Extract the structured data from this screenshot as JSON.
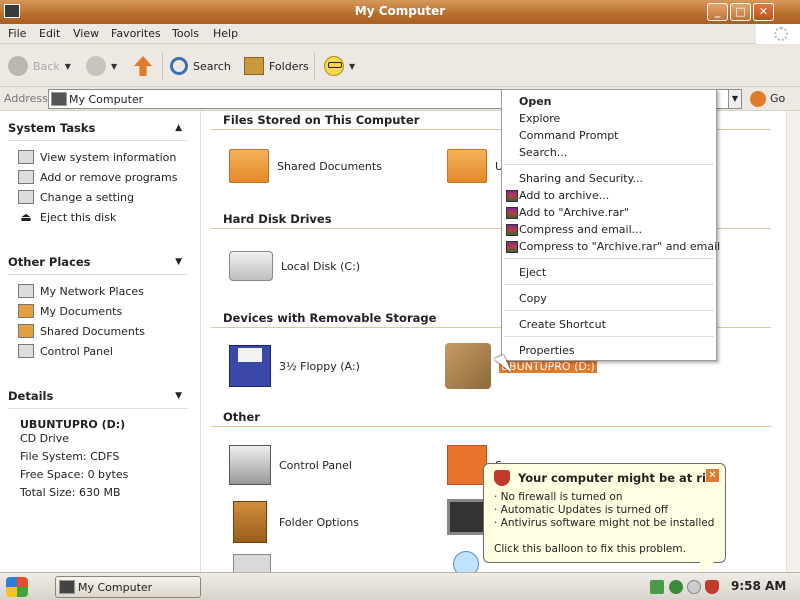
{
  "window": {
    "title": "My Computer"
  },
  "menu": {
    "items": [
      "File",
      "Edit",
      "View",
      "Favorites",
      "Tools",
      "Help"
    ]
  },
  "toolbar": {
    "back": "Back",
    "search": "Search",
    "folders": "Folders"
  },
  "address": {
    "label": "Address",
    "value": "My Computer",
    "go": "Go"
  },
  "sidebar": {
    "system_tasks": {
      "title": "System Tasks",
      "items": [
        "View system information",
        "Add or remove programs",
        "Change a setting",
        "Eject this disk"
      ]
    },
    "other_places": {
      "title": "Other Places",
      "items": [
        "My Network Places",
        "My Documents",
        "Shared Documents",
        "Control Panel"
      ]
    },
    "details": {
      "title": "Details",
      "name": "UBUNTUPRO (D:)",
      "type": "CD Drive",
      "filesystem": "File System: CDFS",
      "free": "Free Space: 0 bytes",
      "total": "Total Size: 630 MB"
    }
  },
  "main": {
    "groups": {
      "files": "Files Stored on This Computer",
      "hdd": "Hard Disk Drives",
      "removable": "Devices with Removable Storage",
      "other": "Other"
    },
    "items": {
      "shared_documents": "Shared Documents",
      "partial_folder": "U",
      "local_disk": "Local Disk (C:)",
      "floppy": "3½ Floppy (A:)",
      "cd_drive": "UBUNTUPRO (D:)",
      "control_panel": "Control Panel",
      "folder_options": "Folder Options",
      "partial_other": "Scanners ar"
    }
  },
  "context_menu": {
    "open": "Open",
    "explore": "Explore",
    "command_prompt": "Command Prompt",
    "search": "Search...",
    "sharing": "Sharing and Security...",
    "add_archive": "Add to archive...",
    "add_rar": "Add to \"Archive.rar\"",
    "compress_email": "Compress and email...",
    "compress_rar_email": "Compress to \"Archive.rar\" and email",
    "eject": "Eject",
    "copy": "Copy",
    "create_shortcut": "Create Shortcut",
    "properties": "Properties"
  },
  "balloon": {
    "title": "Your computer might be at risk",
    "line1": "· No firewall is turned on",
    "line2": "· Automatic Updates is turned off",
    "line3": "· Antivirus software might not be installed",
    "footer": "Click this balloon to fix this problem."
  },
  "taskbar": {
    "window_button": "My Computer",
    "clock": "9:58 AM"
  },
  "colors": {
    "title_bar": "#b86d2c",
    "accent": "#e07b2c",
    "balloon_bg": "#fffee1"
  }
}
